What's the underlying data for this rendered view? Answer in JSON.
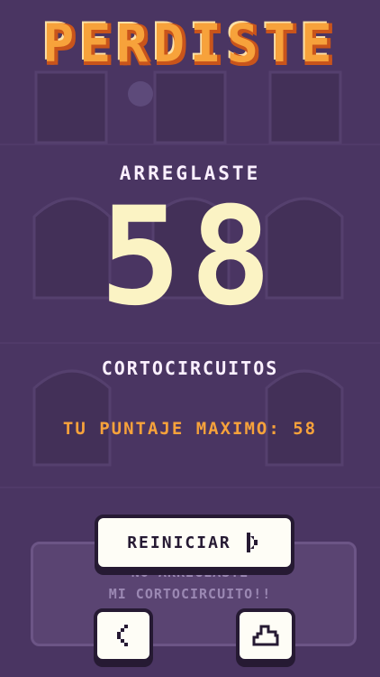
{
  "title": "PERDISTE",
  "fixed_label": "ARREGLASTE",
  "score": "58",
  "unit_label": "CORTOCIRCUITOS",
  "best_score_text": "TU PUNTAJE MAXIMO: 58",
  "restart_button": {
    "label": "REINICIAR",
    "icon": "chevron-right-icon"
  },
  "back_button": {
    "icon": "chevron-left-icon"
  },
  "leaderboard_button": {
    "icon": "podium-icon"
  },
  "speech_bubble": {
    "line1": "NO ARREGLASTE",
    "line2": "MI CORTOCIRCUITO!!"
  },
  "colors": {
    "background": "#4a3562",
    "title": "#f7a23b",
    "score": "#fbf3c4",
    "accent": "#f7a23b"
  }
}
